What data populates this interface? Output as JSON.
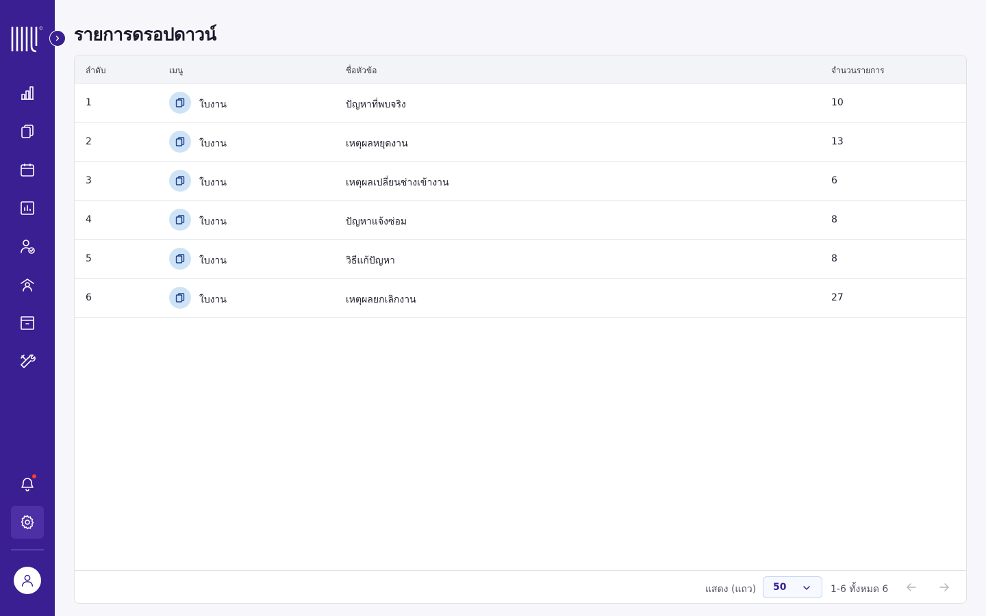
{
  "page": {
    "title": "รายการดรอปดาวน์"
  },
  "colors": {
    "sidebar_bg": "#3a1f92",
    "accent": "#3a1f92",
    "icon_bubble": "#cfe3f7",
    "notification_dot": "#ff3b30"
  },
  "sidebar": {
    "items": [
      {
        "icon": "bar-chart-icon",
        "name": "sidebar-item-dashboard"
      },
      {
        "icon": "documents-icon",
        "name": "sidebar-item-worksheets"
      },
      {
        "icon": "calendar-icon",
        "name": "sidebar-item-calendar"
      },
      {
        "icon": "report-icon",
        "name": "sidebar-item-reports"
      },
      {
        "icon": "user-check-icon",
        "name": "sidebar-item-users"
      },
      {
        "icon": "team-icon",
        "name": "sidebar-item-team"
      },
      {
        "icon": "archive-icon",
        "name": "sidebar-item-archive"
      },
      {
        "icon": "tools-icon",
        "name": "sidebar-item-tools"
      }
    ],
    "bottom": [
      {
        "icon": "bell-icon",
        "name": "notifications-button"
      },
      {
        "icon": "gear-icon",
        "name": "settings-button",
        "active": true
      }
    ]
  },
  "table": {
    "columns": [
      "ลำดับ",
      "เมนู",
      "ชื่อหัวข้อ",
      "จำนวนรายการ"
    ],
    "rows": [
      {
        "no": "1",
        "menu": "ใบงาน",
        "title": "ปัญหาที่พบจริง",
        "count": "10"
      },
      {
        "no": "2",
        "menu": "ใบงาน",
        "title": "เหตุผลหยุดงาน",
        "count": "13"
      },
      {
        "no": "3",
        "menu": "ใบงาน",
        "title": "เหตุผลเปลี่ยนช่างเข้างาน",
        "count": "6"
      },
      {
        "no": "4",
        "menu": "ใบงาน",
        "title": "ปัญหาแจ้งซ่อม",
        "count": "8"
      },
      {
        "no": "5",
        "menu": "ใบงาน",
        "title": "วิธีแก้ปัญหา",
        "count": "8"
      },
      {
        "no": "6",
        "menu": "ใบงาน",
        "title": "เหตุผลยกเลิกงาน",
        "count": "27"
      }
    ]
  },
  "pagination": {
    "rows_label": "แสดง (แถว)",
    "rows_per_page": "50",
    "range_text": "1-6 ทั้งหมด 6"
  }
}
